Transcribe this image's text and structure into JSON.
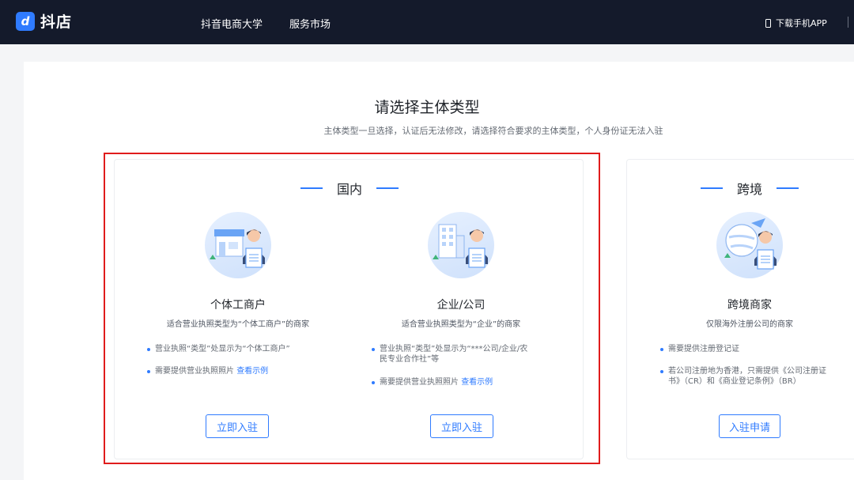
{
  "header": {
    "logo_mark": "d",
    "logo_text": "抖店",
    "nav": [
      "抖音电商大学",
      "服务市场"
    ],
    "download_label": "下载手机APP"
  },
  "page": {
    "title": "请选择主体类型",
    "subtitle": "主体类型一旦选择，认证后无法修改，请选择符合要求的主体类型，个人身份证无法入驻"
  },
  "sections": {
    "domestic": {
      "label": "国内",
      "options": [
        {
          "title": "个体工商户",
          "desc": "适合营业执照类型为“个体工商户”的商家",
          "bullet1": "营业执照“类型”处显示为“个体工商户”",
          "bullet2_text": "需要提供营业执照照片",
          "bullet2_link": "查看示例",
          "button": "立即入驻"
        },
        {
          "title": "企业/公司",
          "desc": "适合营业执照类型为“企业”的商家",
          "bullet1_line1": "营业执照“类型”处显示为“***公司/企业/农",
          "bullet1_line2": "民专业合作社”等",
          "bullet2_text": "需要提供营业执照照片",
          "bullet2_link": "查看示例",
          "button": "立即入驻"
        }
      ]
    },
    "cross_border": {
      "label": "跨境",
      "option": {
        "title": "跨境商家",
        "desc": "仅限海外注册公司的商家",
        "bullet1": "需要提供注册登记证",
        "bullet2_line1": "若公司注册地为香港，只需提供《公司注册证",
        "bullet2_line2": "书》（CR）和《商业登记条例》（BR）",
        "button": "入驻申请"
      }
    }
  },
  "colors": {
    "topbar": "#141a2b",
    "accent": "#2f7bff",
    "highlight": "#e01c1c"
  }
}
